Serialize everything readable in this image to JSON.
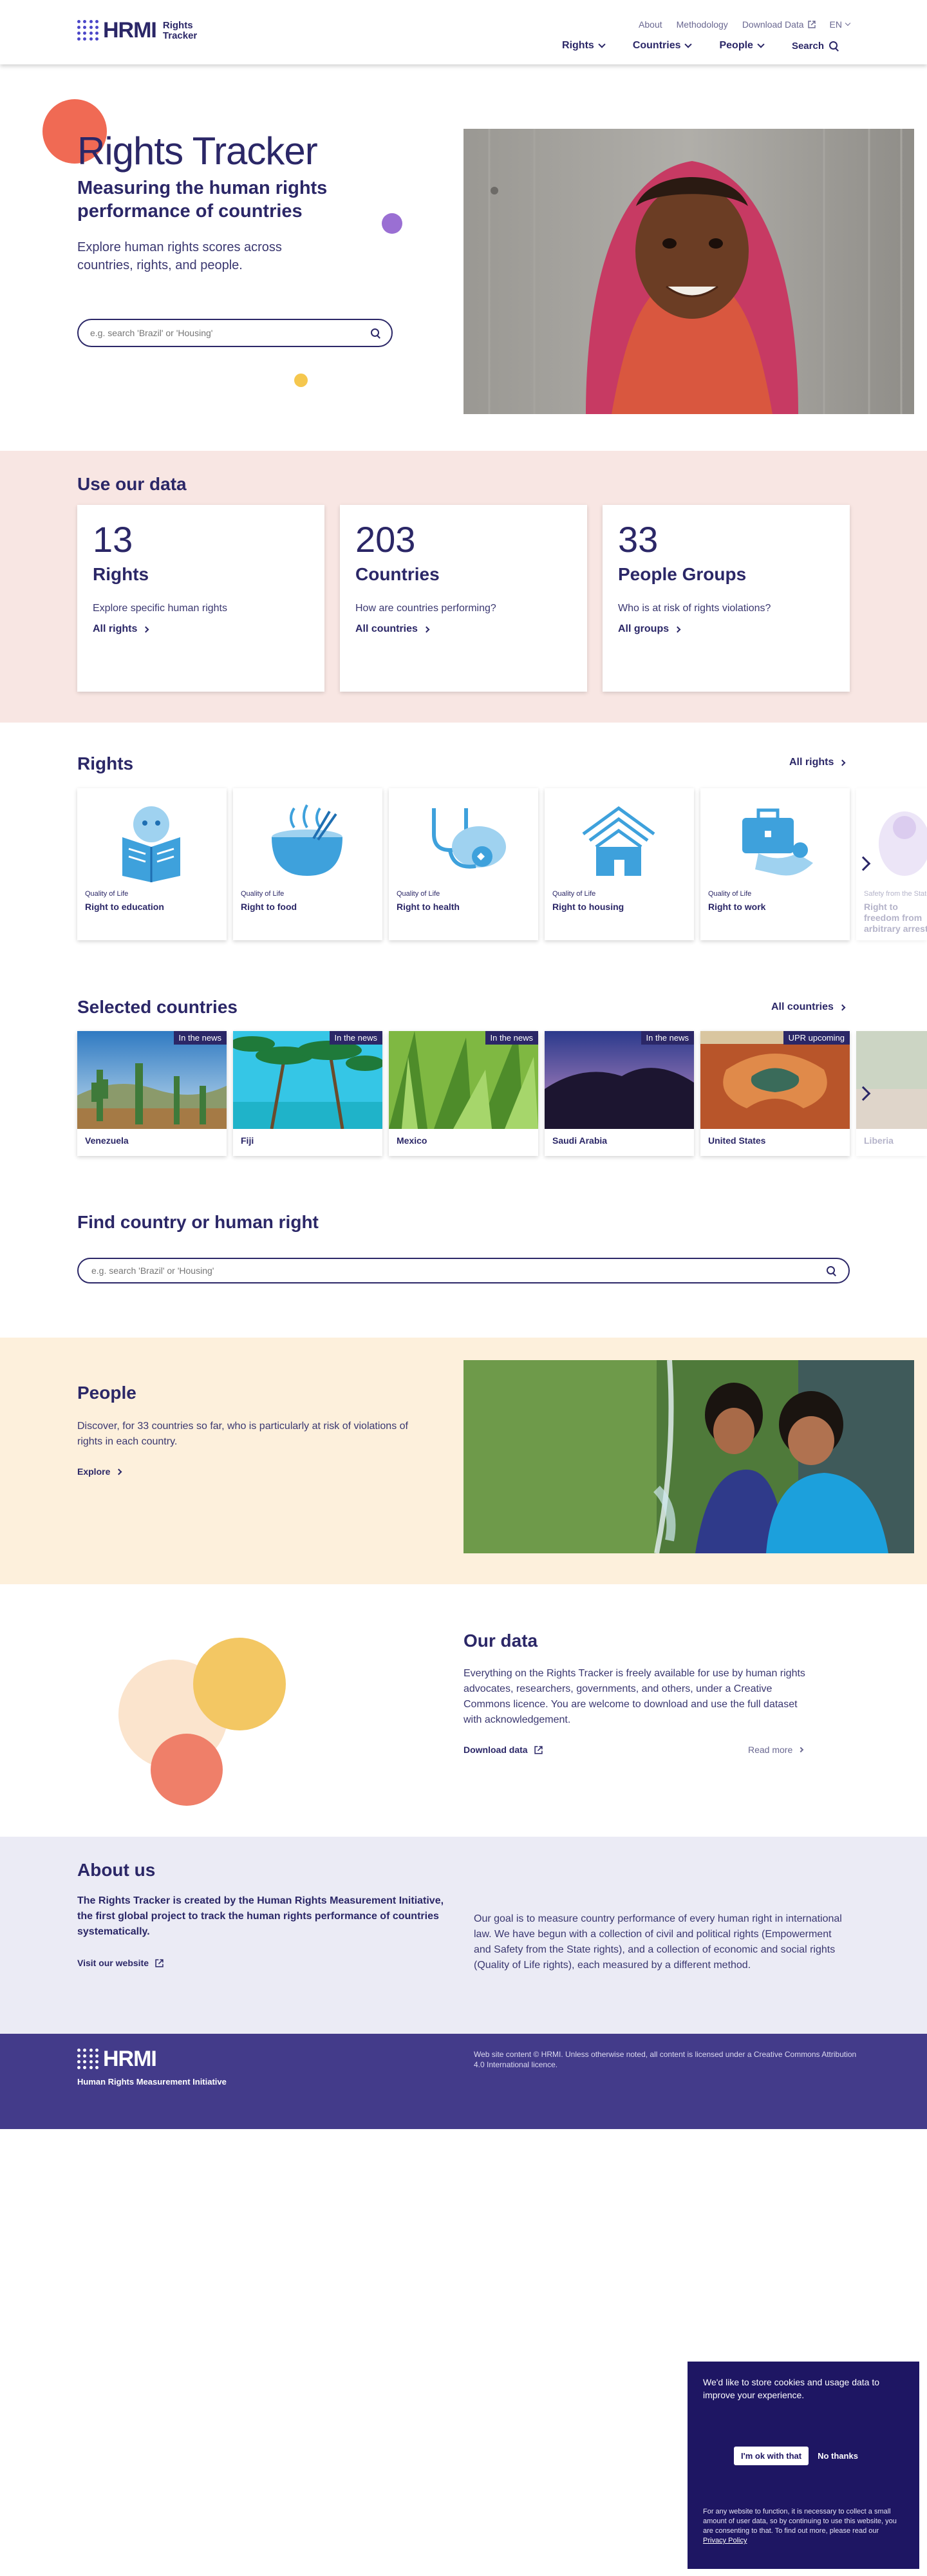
{
  "header": {
    "logo_word": "HRMI",
    "logo_sub_1": "Rights",
    "logo_sub_2": "Tracker",
    "top_links": [
      "About",
      "Methodology",
      "Download Data",
      "EN"
    ],
    "nav": [
      "Rights",
      "Countries",
      "People",
      "Search"
    ]
  },
  "hero": {
    "title": "Rights Tracker",
    "subtitle": "Measuring the human rights performance of countries",
    "description": "Explore human rights scores across countries, rights, and people.",
    "search_placeholder": "e.g. search 'Brazil' or 'Housing'"
  },
  "use_data": {
    "title": "Use our data",
    "cards": [
      {
        "number": "13",
        "name": "Rights",
        "question": "Explore specific human rights",
        "link": "All rights"
      },
      {
        "number": "203",
        "name": "Countries",
        "question": "How are countries performing?",
        "link": "All countries"
      },
      {
        "number": "33",
        "name": "People Groups",
        "question": "Who is at risk of rights violations?",
        "link": "All groups"
      }
    ]
  },
  "rights": {
    "title": "Rights",
    "all_link": "All rights",
    "items": [
      {
        "category": "Quality of Life",
        "name": "Right to education",
        "icon": "education-icon"
      },
      {
        "category": "Quality of Life",
        "name": "Right to food",
        "icon": "food-icon"
      },
      {
        "category": "Quality of Life",
        "name": "Right to health",
        "icon": "health-icon"
      },
      {
        "category": "Quality of Life",
        "name": "Right to housing",
        "icon": "housing-icon"
      },
      {
        "category": "Quality of Life",
        "name": "Right to work",
        "icon": "work-icon"
      },
      {
        "category": "Safety from the State",
        "name": "Right to freedom from arbitrary arrest",
        "icon": "arrest-icon"
      }
    ]
  },
  "countries": {
    "title": "Selected countries",
    "all_link": "All countries",
    "items": [
      {
        "name": "Venezuela",
        "tag": "In the news"
      },
      {
        "name": "Fiji",
        "tag": "In the news"
      },
      {
        "name": "Mexico",
        "tag": "In the news"
      },
      {
        "name": "Saudi Arabia",
        "tag": "In the news"
      },
      {
        "name": "United States",
        "tag": "UPR upcoming"
      },
      {
        "name": "Liberia",
        "tag": ""
      }
    ]
  },
  "find": {
    "title": "Find country or human right",
    "placeholder": "e.g. search 'Brazil' or 'Housing'"
  },
  "people": {
    "title": "People",
    "description": "Discover, for 33 countries so far, who is particularly at risk of violations of rights in each country.",
    "link": "Explore"
  },
  "our_data": {
    "title": "Our data",
    "description": "Everything on the Rights Tracker is freely available for use by human rights advocates, researchers, governments, and others, under a Creative Commons licence. You are welcome to download and use the full dataset with acknowledgement.",
    "download": "Download data",
    "read_more": "Read more"
  },
  "about": {
    "title": "About us",
    "left": "The Rights Tracker is created by the Human Rights Measurement Initiative, the first global project to track the human rights performance of countries systematically.",
    "link": "Visit our website",
    "right": "Our goal is to measure country performance of every human right in international law. We have begun with a collection of civil and political rights (Empowerment and Safety from the State rights), and a collection of economic and social rights (Quality of Life rights), each measured by a different method."
  },
  "footer": {
    "logo_word": "HRMI",
    "tagline": "Human Rights Measurement Initiative",
    "note": "Web site content © HRMI. Unless otherwise noted, all content is licensed under a Creative Commons Attribution 4.0 International licence."
  },
  "cookie": {
    "message": "We'd like to store cookies and usage data to improve your experience.",
    "accept": "I'm ok with that",
    "decline": "No thanks",
    "small_text": "For any website to function, it is necessary to collect a small amount of user data, so by continuing to use this website, you are consenting to that. To find out more, please read our",
    "policy_link": "Privacy Policy"
  },
  "colors": {
    "navy": "#2b2767",
    "pink_band": "#f8e6e3",
    "cream_band": "#fdf0dc",
    "lavender_band": "#ebebf5",
    "footer": "#433b8a",
    "cookie": "#1e1663",
    "icon_blue": "#3ea1dc"
  }
}
